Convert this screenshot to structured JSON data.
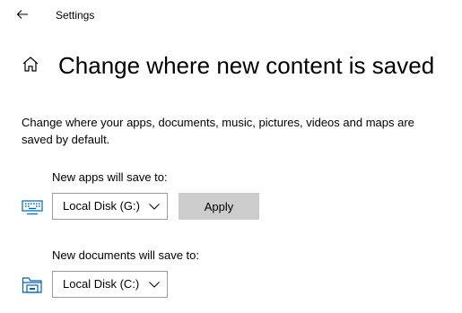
{
  "window": {
    "title": "Settings"
  },
  "header": {
    "page_title": "Change where new content is saved"
  },
  "description": "Change where your apps, documents, music, pictures, videos and maps are saved by default.",
  "apps": {
    "label": "New apps will save to:",
    "selected": "Local Disk (G:)",
    "icon": "keyboard-icon",
    "apply_label": "Apply"
  },
  "documents": {
    "label": "New documents will save to:",
    "selected": "Local Disk (C:)",
    "icon": "folder-icon"
  },
  "colors": {
    "accent": "#0063b1",
    "apply_bg": "#cccccc",
    "dropdown_border": "#9a9a9a"
  }
}
